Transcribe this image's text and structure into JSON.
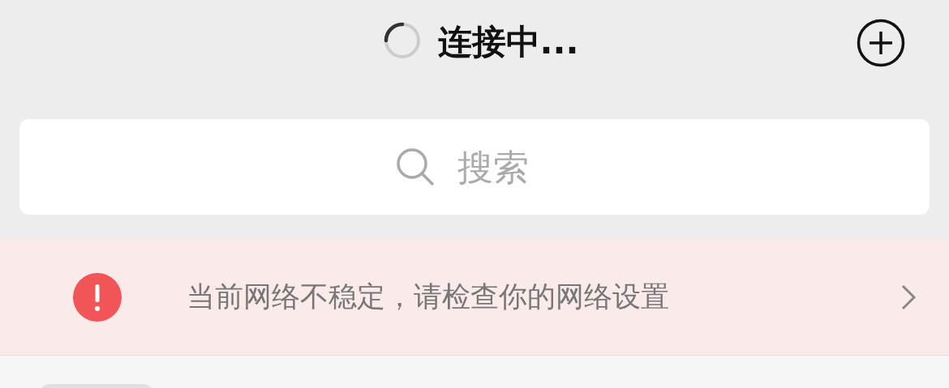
{
  "header": {
    "title": "连接中...",
    "loading": true
  },
  "search": {
    "placeholder": "搜索"
  },
  "alert": {
    "message": "当前网络不稳定，请检查你的网络设置"
  }
}
